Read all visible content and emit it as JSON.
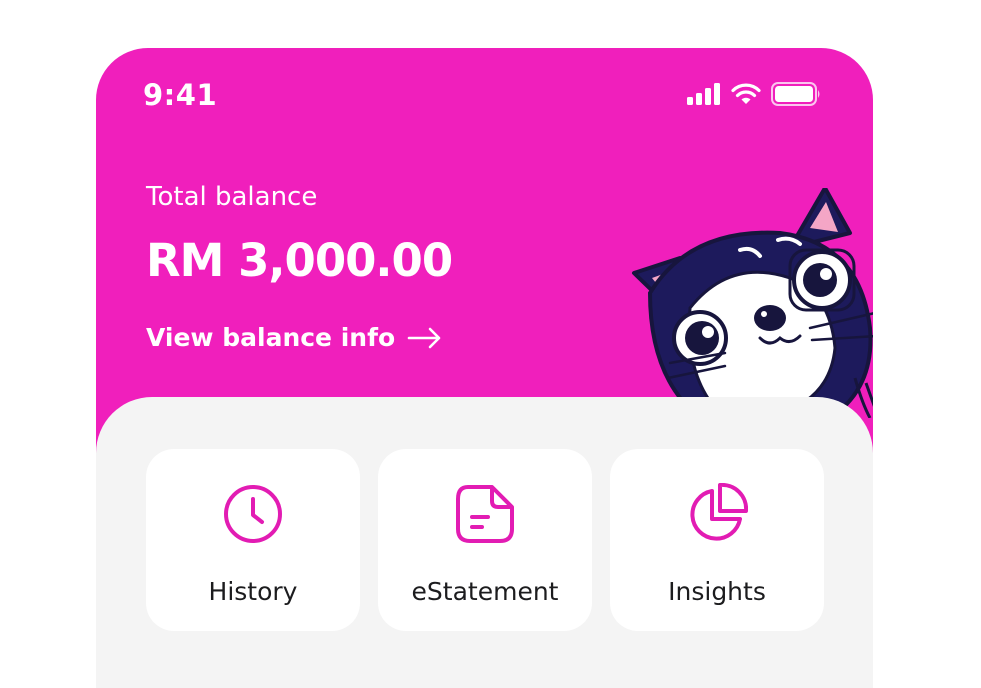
{
  "status_bar": {
    "time": "9:41",
    "icons": [
      "signal-icon",
      "wifi-icon",
      "battery-icon"
    ]
  },
  "balance": {
    "label": "Total balance",
    "amount": "RM 3,000.00",
    "link_label": "View balance info",
    "link_icon": "arrow-right-icon"
  },
  "mascot": "cat-illustration",
  "actions": [
    {
      "label": "History",
      "icon": "clock-icon"
    },
    {
      "label": "eStatement",
      "icon": "document-icon"
    },
    {
      "label": "Insights",
      "icon": "pie-chart-icon"
    }
  ],
  "colors": {
    "brand": "#f01fbc",
    "panel": "#f4f4f4",
    "tile": "#ffffff",
    "text_dark": "#1c1c1e"
  }
}
